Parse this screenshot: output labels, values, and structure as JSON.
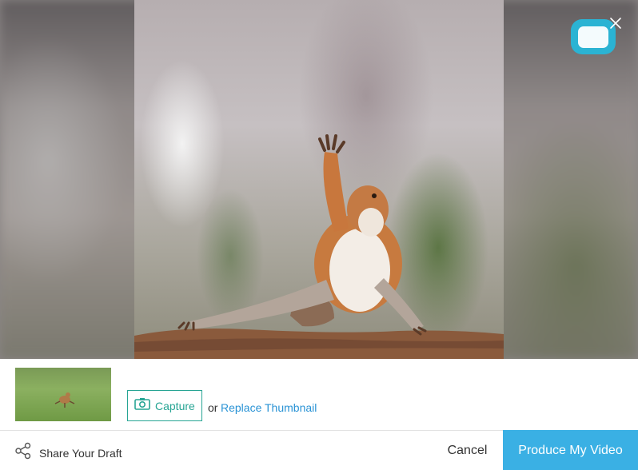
{
  "preview": {
    "media_description": "squirrel-photo"
  },
  "thumbnail_bar": {
    "capture_label": "Capture",
    "or_text": "or",
    "replace_label": "Replace Thumbnail"
  },
  "footer": {
    "share_label": "Share Your Draft",
    "cancel_label": "Cancel",
    "produce_label": "Produce My Video"
  },
  "colors": {
    "accent_teal": "#27a594",
    "link_blue": "#2a93d5",
    "primary_button": "#3ab0e4",
    "logo_teal": "#2bb3d3"
  },
  "icons": [
    "close-icon",
    "logo-icon",
    "camera-icon",
    "share-icon"
  ]
}
